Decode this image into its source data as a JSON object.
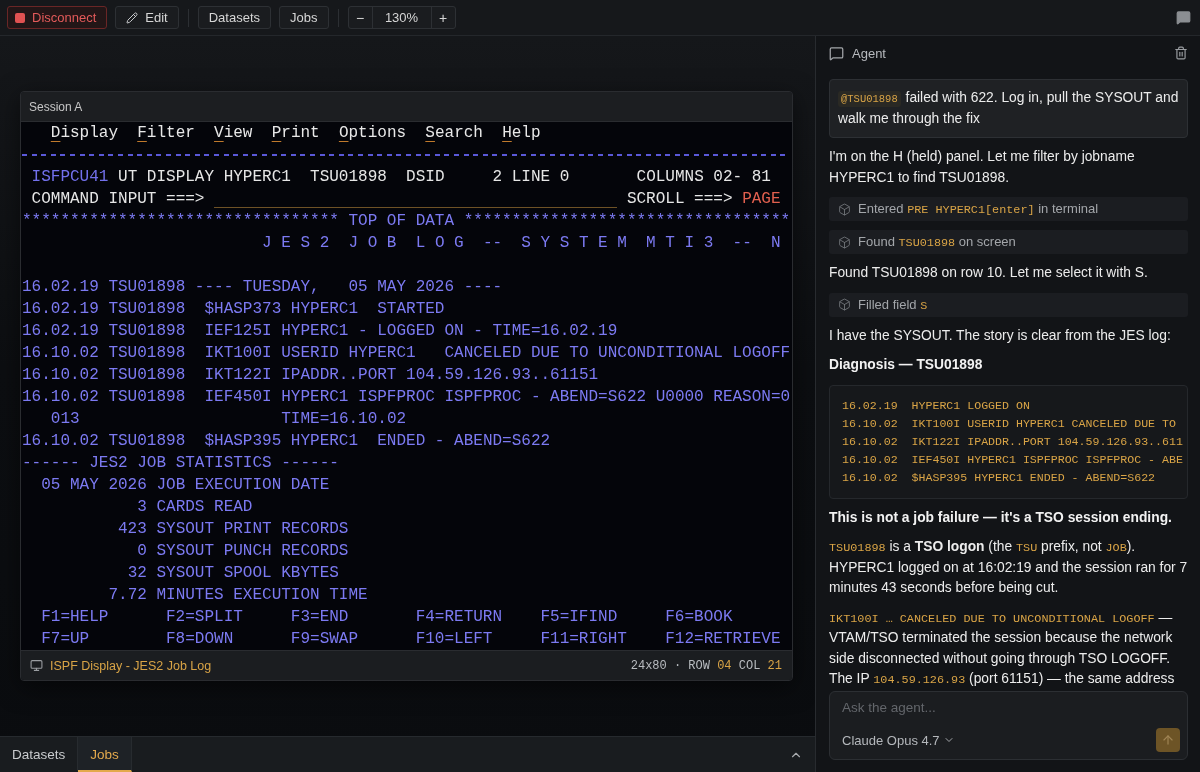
{
  "toolbar": {
    "actions": [
      {
        "kind": "disconnect",
        "label": "Disconnect"
      },
      {
        "kind": "edit",
        "label": "Edit"
      }
    ],
    "views": [
      {
        "label": "Datasets"
      },
      {
        "label": "Jobs"
      }
    ],
    "zoom": {
      "decrease": "−",
      "level": "130%",
      "increase": "+"
    }
  },
  "terminal": {
    "title": "Session A",
    "rows": [
      {
        "kind": "action_bar",
        "items": [
          "Display",
          "Filter",
          "View",
          "Print",
          "Options",
          "Search",
          "Help"
        ]
      },
      {
        "kind": "rule"
      },
      {
        "kind": "line",
        "segments": [
          {
            "kind": "label",
            "text": " ISFPCU41"
          },
          {
            "kind": "text",
            "text": " UT DISPLAY HYPERC1"
          },
          {
            "kind": "text",
            "text": "  TSU01898"
          },
          {
            "kind": "text",
            "text": "  DSID"
          },
          {
            "kind": "text",
            "text": "     2 LINE 0"
          },
          {
            "kind": "text",
            "text": "       COLUMNS 02- 81"
          }
        ]
      },
      {
        "kind": "line",
        "segments": [
          {
            "kind": "text",
            "text": " COMMAND INPUT ===>"
          },
          {
            "kind": "input"
          },
          {
            "kind": "text",
            "text": "SCROLL ===>"
          },
          {
            "kind": "alert",
            "text": " PAGE"
          }
        ]
      },
      {
        "kind": "line",
        "segments": [
          {
            "kind": "data",
            "text": "********************************* TOP OF DATA **********************************"
          }
        ]
      },
      {
        "kind": "line",
        "segments": [
          {
            "kind": "data",
            "text": "                         J E S 2  J O B  L O G  --  S Y S T E M  M T I 3  --  N"
          }
        ]
      },
      {
        "kind": "blank"
      },
      {
        "kind": "line",
        "segments": [
          {
            "kind": "data",
            "text": "16.02.19 TSU01898 ---- TUESDAY,   05 MAY 2026 ----"
          }
        ]
      },
      {
        "kind": "line",
        "segments": [
          {
            "kind": "data",
            "text": "16.02.19 TSU01898  $HASP373 HYPERC1  STARTED"
          }
        ]
      },
      {
        "kind": "line",
        "segments": [
          {
            "kind": "data",
            "text": "16.02.19 TSU01898  IEF125I HYPERC1 - LOGGED ON - TIME=16.02.19"
          }
        ]
      },
      {
        "kind": "line",
        "segments": [
          {
            "kind": "data",
            "text": "16.10.02 TSU01898  IKT100I USERID HYPERC1   CANCELED DUE TO UNCONDITIONAL LOGOFF"
          }
        ]
      },
      {
        "kind": "line",
        "segments": [
          {
            "kind": "data",
            "text": "16.10.02 TSU01898  IKT122I IPADDR..PORT 104.59.126.93..61151"
          }
        ]
      },
      {
        "kind": "line",
        "segments": [
          {
            "kind": "data",
            "text": "16.10.02 TSU01898  IEF450I HYPERC1 ISPFPROC ISPFPROC - ABEND=S622 U0000 REASON=0"
          }
        ]
      },
      {
        "kind": "line",
        "segments": [
          {
            "kind": "data",
            "text": "   013"
          },
          {
            "kind": "data",
            "text": "                     TIME=16.10.02"
          }
        ]
      },
      {
        "kind": "line",
        "segments": [
          {
            "kind": "data",
            "text": "16.10.02 TSU01898  $HASP395 HYPERC1  ENDED - ABEND=S622"
          }
        ]
      },
      {
        "kind": "line",
        "segments": [
          {
            "kind": "data",
            "text": "------ JES2 JOB STATISTICS ------"
          }
        ]
      },
      {
        "kind": "line",
        "segments": [
          {
            "kind": "data",
            "text": "  05 MAY 2026 JOB EXECUTION DATE"
          }
        ]
      },
      {
        "kind": "line",
        "segments": [
          {
            "kind": "data",
            "text": "            3 CARDS READ"
          }
        ]
      },
      {
        "kind": "line",
        "segments": [
          {
            "kind": "data",
            "text": "          423 SYSOUT PRINT RECORDS"
          }
        ]
      },
      {
        "kind": "line",
        "segments": [
          {
            "kind": "data",
            "text": "            0 SYSOUT PUNCH RECORDS"
          }
        ]
      },
      {
        "kind": "line",
        "segments": [
          {
            "kind": "data",
            "text": "           32 SYSOUT SPOOL KBYTES"
          }
        ]
      },
      {
        "kind": "line",
        "segments": [
          {
            "kind": "data",
            "text": "         7.72 MINUTES EXECUTION TIME"
          }
        ]
      },
      {
        "kind": "fkeys",
        "keys": [
          "F1=HELP",
          "F2=SPLIT",
          "F3=END",
          "F4=RETURN",
          "F5=IFIND",
          "F6=BOOK"
        ]
      },
      {
        "kind": "fkeys",
        "keys": [
          "F7=UP",
          "F8=DOWN",
          "F9=SWAP",
          "F10=LEFT",
          "F11=RIGHT",
          "F12=RETRIEVE"
        ]
      }
    ],
    "status": {
      "title": "ISPF Display - JES2 Job Log",
      "position": [
        {
          "kind": "label",
          "text": "24x80 · ROW"
        },
        {
          "kind": "value",
          "text": "04"
        },
        {
          "kind": "label",
          "text": "COL"
        },
        {
          "kind": "value",
          "text": "21"
        }
      ]
    }
  },
  "bottom_tabs": [
    {
      "label": "Datasets",
      "selected": false
    },
    {
      "label": "Jobs",
      "selected": true
    }
  ],
  "agent": {
    "title": "Agent",
    "messages": [
      {
        "kind": "user",
        "segments": [
          {
            "kind": "mention",
            "text": "@TSU01898"
          },
          {
            "kind": "text",
            "text": " failed with 622. Log in, pull the SYSOUT and walk me through the fix"
          }
        ]
      },
      {
        "kind": "text",
        "segments": [
          {
            "kind": "text",
            "text": "I'm on the H (held) panel. Let me filter by jobname HYPERC1 to find TSU01898."
          }
        ]
      },
      {
        "kind": "tool",
        "segments": [
          {
            "kind": "text",
            "text": "Entered "
          },
          {
            "kind": "code",
            "text": "PRE HYPERC1[enter]"
          },
          {
            "kind": "text",
            "text": " in terminal"
          }
        ]
      },
      {
        "kind": "tool",
        "segments": [
          {
            "kind": "text",
            "text": "Found "
          },
          {
            "kind": "code",
            "text": "TSU01898"
          },
          {
            "kind": "text",
            "text": " on screen"
          }
        ]
      },
      {
        "kind": "text",
        "segments": [
          {
            "kind": "text",
            "text": "Found TSU01898 on row 10. Let me select it with S."
          }
        ]
      },
      {
        "kind": "tool",
        "segments": [
          {
            "kind": "text",
            "text": "Filled field "
          },
          {
            "kind": "code",
            "text": "S"
          }
        ]
      },
      {
        "kind": "text",
        "segments": [
          {
            "kind": "text",
            "text": "I have the SYSOUT. The story is clear from the JES log:"
          }
        ]
      },
      {
        "kind": "heading",
        "segments": [
          {
            "kind": "text",
            "text": "Diagnosis — TSU01898"
          }
        ]
      },
      {
        "kind": "code_block",
        "lines": [
          "16.02.19  HYPERC1 LOGGED ON",
          "16.10.02  IKT100I USERID HYPERC1 CANCELED DUE TO",
          "16.10.02  IKT122I IPADDR..PORT 104.59.126.93..611",
          "16.10.02  IEF450I HYPERC1 ISPFPROC ISPFPROC - ABE",
          "16.10.02  $HASP395 HYPERC1 ENDED - ABEND=S622"
        ]
      },
      {
        "kind": "heading",
        "segments": [
          {
            "kind": "text",
            "text": "This is not a job failure — it's a TSO session ending."
          }
        ]
      },
      {
        "kind": "text",
        "segments": [
          {
            "kind": "code",
            "text": "TSU01898"
          },
          {
            "kind": "text",
            "text": " is a "
          },
          {
            "kind": "bold",
            "text": "TSO logon"
          },
          {
            "kind": "text",
            "text": " (the "
          },
          {
            "kind": "code",
            "text": "TSU"
          },
          {
            "kind": "text",
            "text": " prefix, not "
          },
          {
            "kind": "code",
            "text": "JOB"
          },
          {
            "kind": "text",
            "text": "). HYPERC1 logged on at 16:02:19 and the session ran for 7 minutes 43 seconds before being cut."
          }
        ]
      },
      {
        "kind": "text",
        "segments": [
          {
            "kind": "code",
            "text": "IKT100I … CANCELED DUE TO UNCONDITIONAL LOGOFF"
          },
          {
            "kind": "text",
            "text": " — VTAM/TSO terminated the session because the network side disconnected without going through TSO LOGOFF. The IP "
          },
          {
            "kind": "code",
            "text": "104.59.126.93"
          },
          {
            "kind": "text",
            "text": " (port 61151) — the same address"
          }
        ]
      }
    ],
    "composer": {
      "placeholder": "Ask the agent...",
      "model": "Claude Opus 4.7"
    }
  }
}
